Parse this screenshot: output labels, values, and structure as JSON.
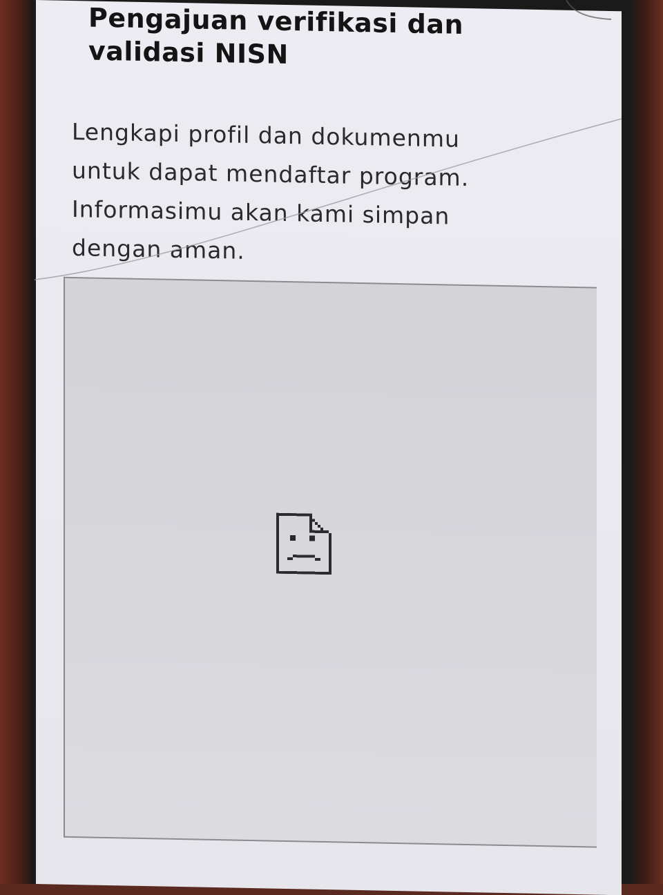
{
  "page": {
    "title_line1": "Pengajuan verifikasi dan",
    "title_line2": "validasi NISN",
    "description_lines": [
      "Lengkapi profil dan dokumenmu",
      "untuk dapat mendaftar program.",
      "Informasimu akan kami simpan",
      "dengan aman."
    ]
  },
  "image_placeholder": {
    "icon": "broken-image-icon",
    "state": "failed-to-load"
  },
  "colors": {
    "background": "#ececf2",
    "text": "#141414",
    "placeholder_bg": "#d7d7dc",
    "border": "#8a8a90"
  }
}
